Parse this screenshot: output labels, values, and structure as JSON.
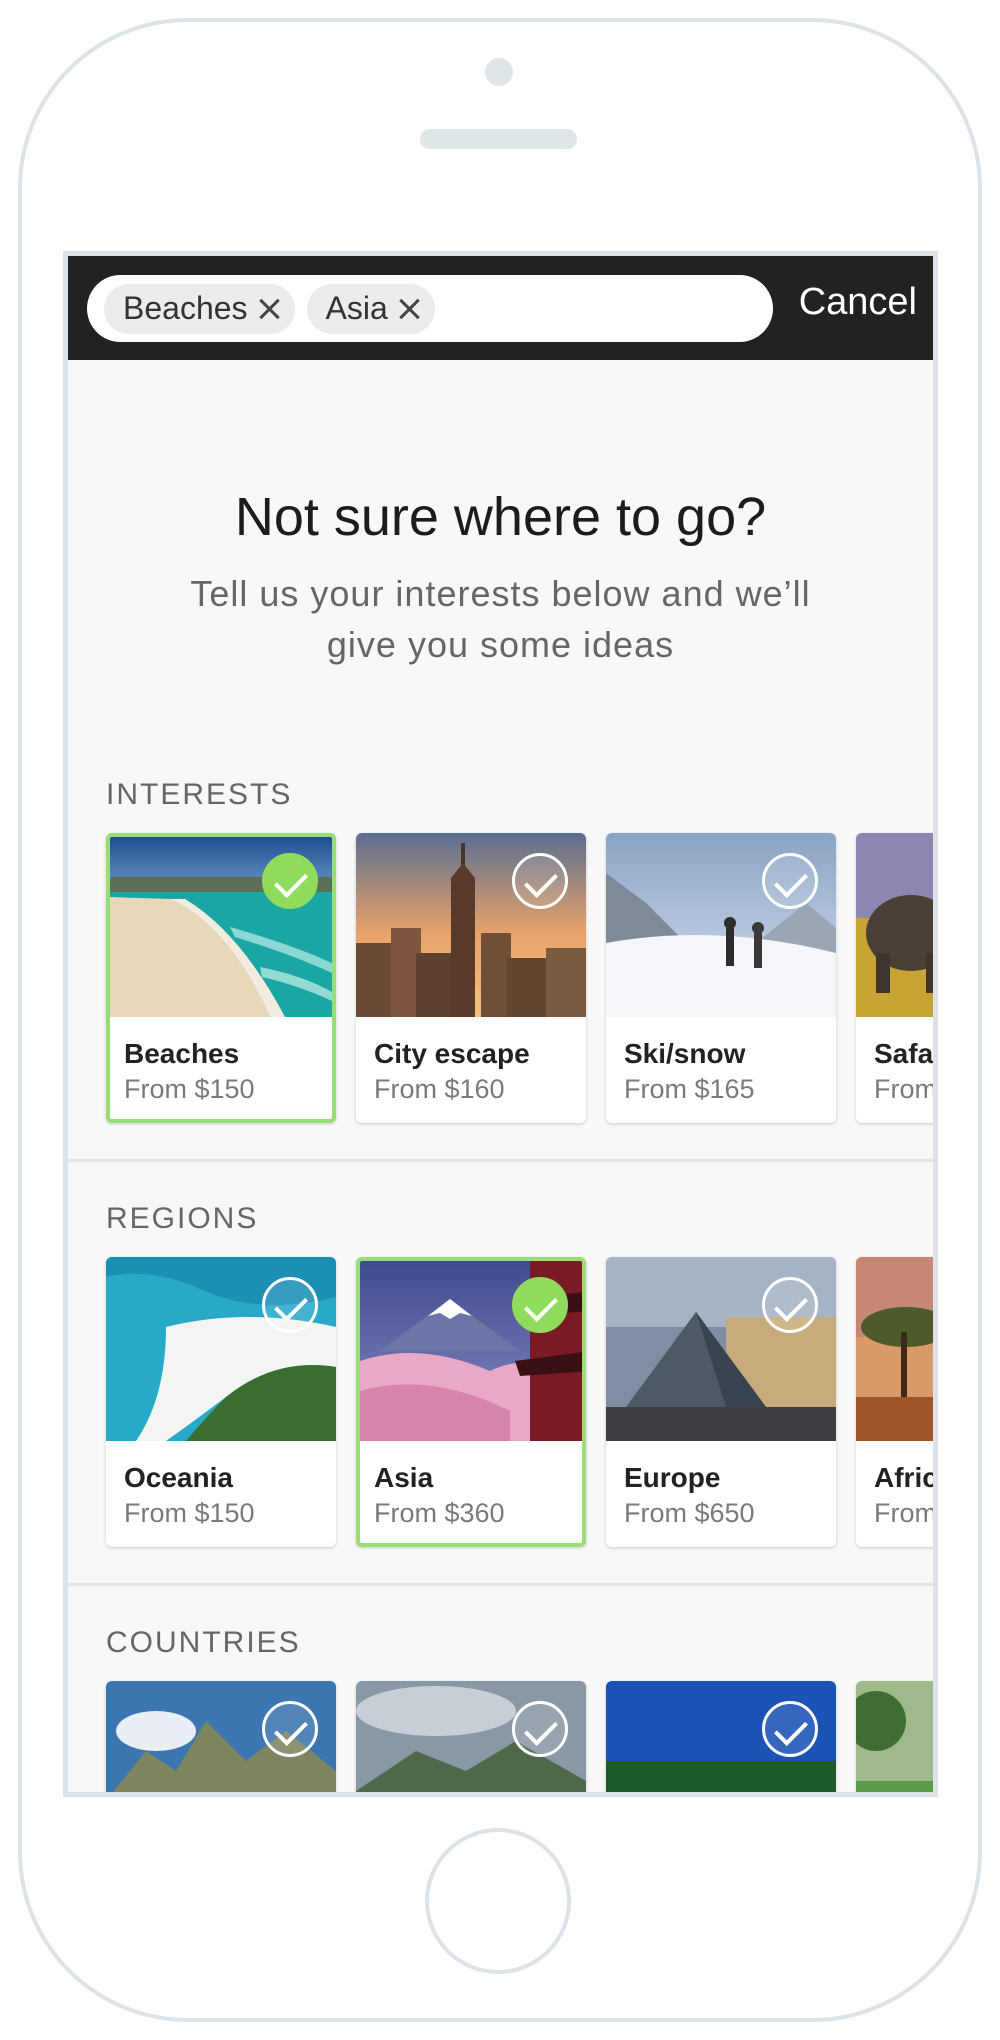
{
  "search": {
    "chips": [
      {
        "label": "Beaches"
      },
      {
        "label": "Asia"
      }
    ],
    "cancel_label": "Cancel"
  },
  "hero": {
    "title": "Not sure where to go?",
    "subtitle": "Tell us your interests below and we’ll give you some ideas"
  },
  "sections": {
    "interests": {
      "label": "INTERESTS",
      "cards": [
        {
          "title": "Beaches",
          "price": "From $150",
          "selected": true
        },
        {
          "title": "City escape",
          "price": "From $160",
          "selected": false
        },
        {
          "title": "Ski/snow",
          "price": "From $165",
          "selected": false
        },
        {
          "title": "Safa",
          "price": "From",
          "selected": false
        }
      ]
    },
    "regions": {
      "label": "REGIONS",
      "cards": [
        {
          "title": "Oceania",
          "price": "From $150",
          "selected": false
        },
        {
          "title": "Asia",
          "price": "From $360",
          "selected": true
        },
        {
          "title": "Europe",
          "price": "From $650",
          "selected": false
        },
        {
          "title": "Afric",
          "price": "From",
          "selected": false
        }
      ]
    },
    "countries": {
      "label": "COUNTRIES"
    }
  },
  "colors": {
    "selected_accent": "#8fdc5c",
    "top_bar": "#222222",
    "screen_background": "#f8f8f8"
  }
}
